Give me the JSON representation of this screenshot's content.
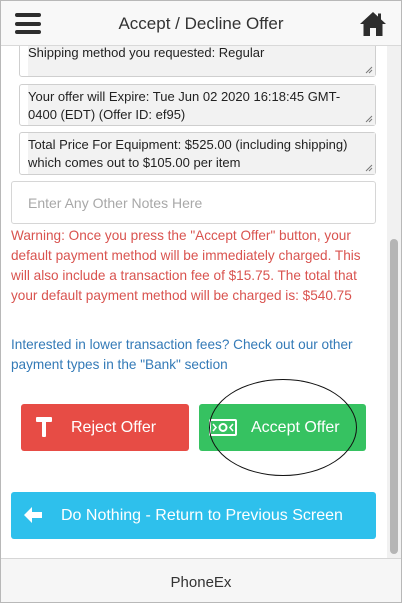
{
  "header": {
    "title": "Accept / Decline Offer",
    "menu_icon": "hamburger-menu-icon",
    "home_icon": "home-icon"
  },
  "offer": {
    "shipping_line": "Shipping method you requested: Regular",
    "expire_line": "Your offer will Expire: Tue Jun 02 2020 16:18:45 GMT-0400 (EDT) (Offer ID: ef95)",
    "price_line": "Total Price For Equipment: $525.00 (including shipping) which comes out to $105.00 per item"
  },
  "notes": {
    "placeholder": "Enter Any Other Notes Here",
    "value": ""
  },
  "warning_text": "Warning: Once you press the \"Accept Offer\" button, your default payment method will be immediately charged. This will also include a transaction fee of $15.75. The total that your default payment method will be charged is: $540.75",
  "fee_link_text": "Interested in lower transaction fees? Check out our other payment types in the \"Bank\" section",
  "buttons": {
    "reject": {
      "label": "Reject Offer",
      "icon": "gavel-icon"
    },
    "accept": {
      "label": "Accept Offer",
      "icon": "money-icon"
    },
    "back": {
      "label": "Do Nothing - Return to Previous Screen",
      "icon": "arrow-left-icon"
    }
  },
  "footer": {
    "title": "PhoneEx"
  },
  "colors": {
    "reject": "#e74c45",
    "accept": "#36c261",
    "back": "#2ec0ec",
    "warning": "#d9534f",
    "link": "#337ab7"
  }
}
